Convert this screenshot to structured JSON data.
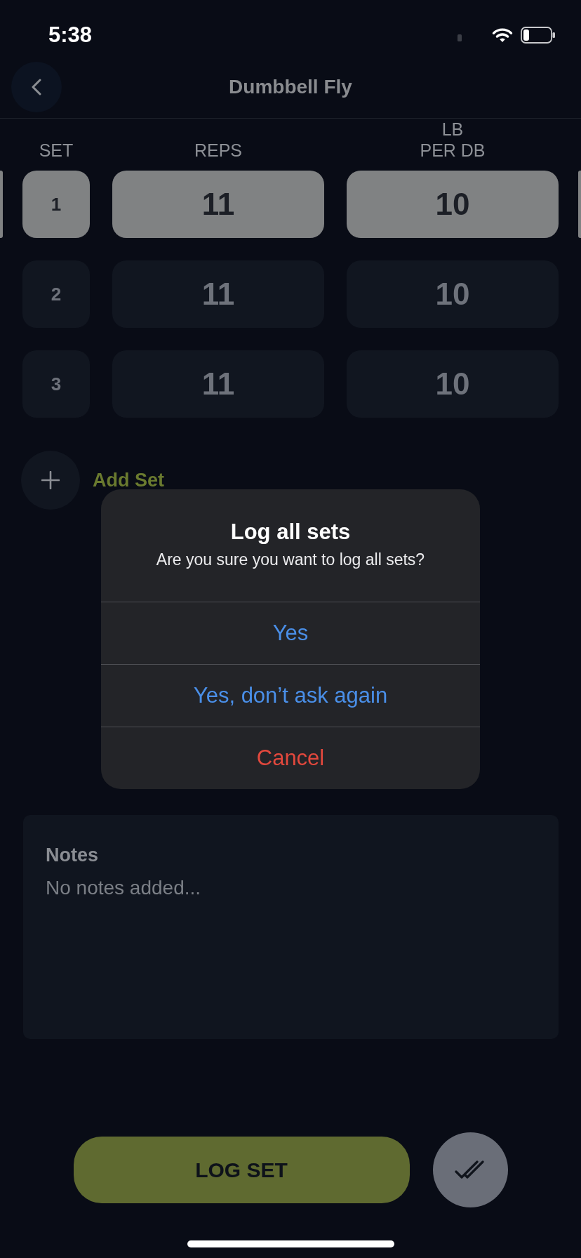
{
  "status_bar": {
    "time": "5:38"
  },
  "header": {
    "title": "Dumbbell Fly"
  },
  "table": {
    "columns": [
      "SET",
      "REPS",
      "LB\nPER DB"
    ],
    "rows": [
      {
        "set": "1",
        "reps": "11",
        "weight": "10",
        "selected": true
      },
      {
        "set": "2",
        "reps": "11",
        "weight": "10",
        "selected": false
      },
      {
        "set": "3",
        "reps": "11",
        "weight": "10",
        "selected": false
      }
    ]
  },
  "add_set": {
    "label": "Add Set"
  },
  "notes": {
    "title": "Notes",
    "text": "No notes added..."
  },
  "footer": {
    "log_button": "LOG SET"
  },
  "dialog": {
    "title": "Log all sets",
    "message": "Are you sure you want to log all sets?",
    "actions": [
      {
        "label": "Yes",
        "kind": "default"
      },
      {
        "label": "Yes, don’t ask again",
        "kind": "default"
      },
      {
        "label": "Cancel",
        "kind": "destructive"
      }
    ]
  }
}
